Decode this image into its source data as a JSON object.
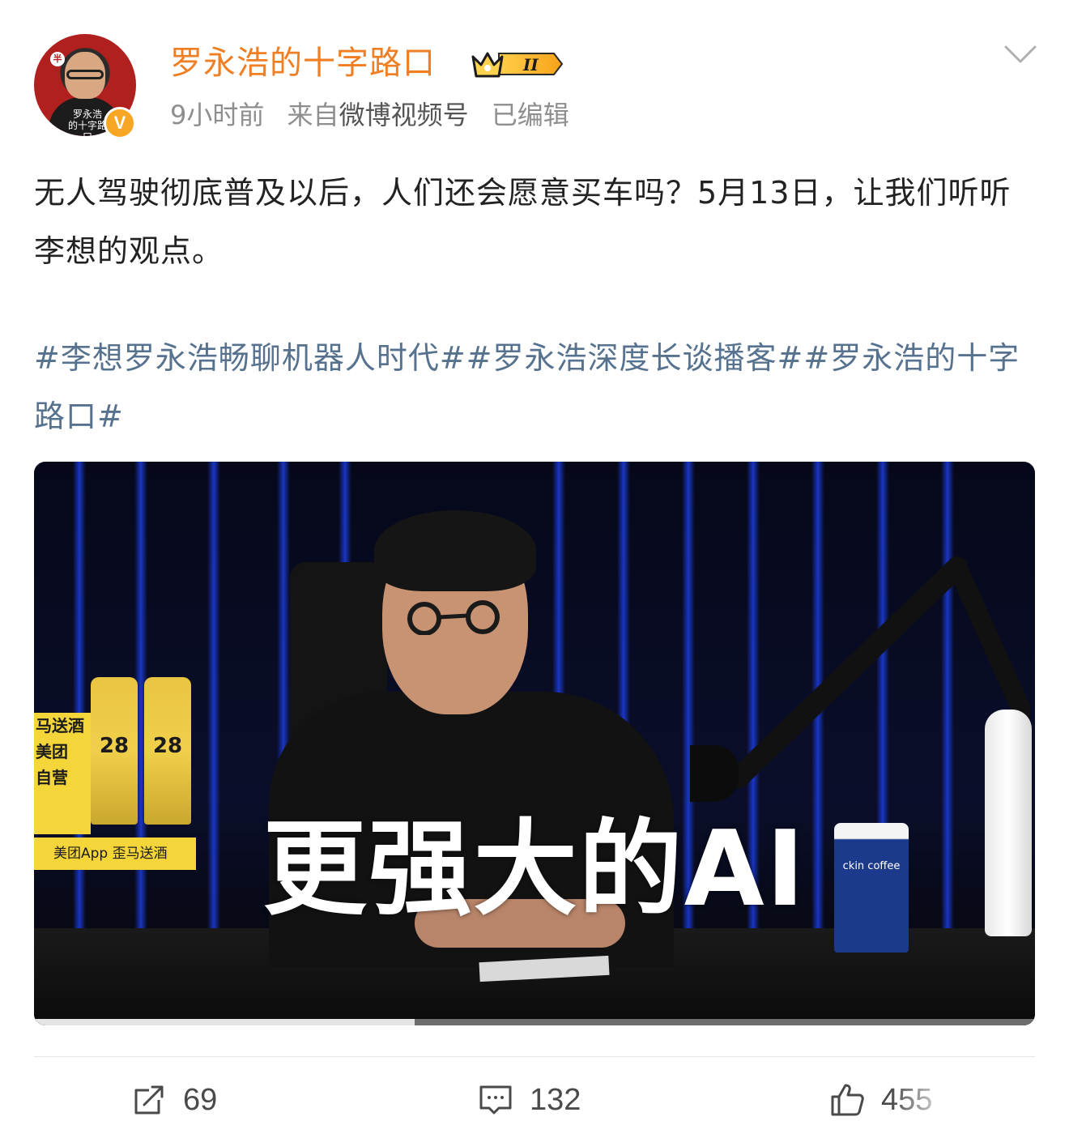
{
  "header": {
    "avatar_text": "罗永浩\n的十字路口",
    "avatar_mark": "半",
    "verified_mark": "V",
    "username": "罗永浩的十字路口",
    "badge_level": "II",
    "time": "9小时前",
    "source_prefix": "来自",
    "source": "微博视频号",
    "edited": "已编辑"
  },
  "post": {
    "text": "无人驾驶彻底普及以后，人们还会愿意买车吗？5月13日，让我们听听李想的观点。",
    "hashtags": "#李想罗永浩畅聊机器人时代##罗永浩深度长谈播客##罗永浩的十字路口#"
  },
  "video": {
    "caption": "更强大的AI",
    "can_label_1": "28",
    "can_label_2": "28",
    "sign_lines": [
      "马送酒",
      "美团",
      "自营"
    ],
    "bar_text": "美团App  歪马送酒",
    "cup_brand": "ckin coffee",
    "progress": 0.38
  },
  "actions": {
    "repost_count": "69",
    "comment_count": "132",
    "like_count": "455"
  },
  "colors": {
    "username": "#f07e23",
    "hashtag": "#57728f",
    "badge": "#f6a623"
  }
}
